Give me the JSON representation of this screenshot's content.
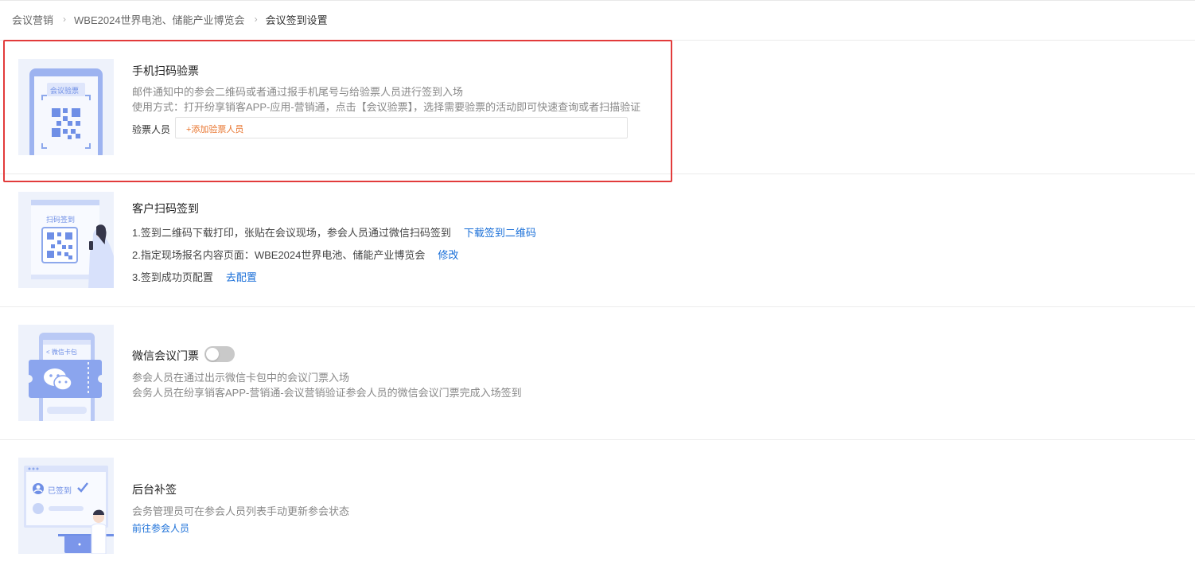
{
  "breadcrumb": {
    "items": [
      "会议营销",
      "WBE2024世界电池、储能产业博览会"
    ],
    "separator": "›",
    "current": "会议签到设置"
  },
  "colors": {
    "accent": "#1a6fd8",
    "orange": "#e8752e",
    "highlight": "#e23b3b",
    "illustration": "#8da8ec"
  },
  "mobile_scan": {
    "title": "手机扫码验票",
    "desc1": "邮件通知中的参会二维码或者通过报手机尾号与给验票人员进行签到入场",
    "desc2": "使用方式：打开纷享销客APP-应用-营销通，点击【会议验票】，选择需要验票的活动即可快速查询或者扫描验证",
    "checker_label": "验票人员",
    "add_checker": "+添加验票人员",
    "illustration_text": "会议验票"
  },
  "customer_scan": {
    "title": "客户扫码签到",
    "step1": "1.签到二维码下载打印，张贴在会议现场，参会人员通过微信扫码签到",
    "step1_link": "下载签到二维码",
    "step2": "2.指定现场报名内容页面：WBE2024世界电池、储能产业博览会",
    "step2_link": "修改",
    "step3": "3.签到成功页配置",
    "step3_link": "去配置",
    "illustration_text": "扫码签到"
  },
  "wechat_ticket": {
    "title": "微信会议门票",
    "toggle_on": false,
    "desc1": "参会人员在通过出示微信卡包中的会议门票入场",
    "desc2": "会务人员在纷享销客APP-营销通-会议营销验证参会人员的微信会议门票完成入场签到",
    "illustration_text": "< 微信卡包"
  },
  "backend_signin": {
    "title": "后台补签",
    "desc": "会务管理员可在参会人员列表手动更新参会状态",
    "link": "前往参会人员",
    "illustration_text": "已签到"
  }
}
